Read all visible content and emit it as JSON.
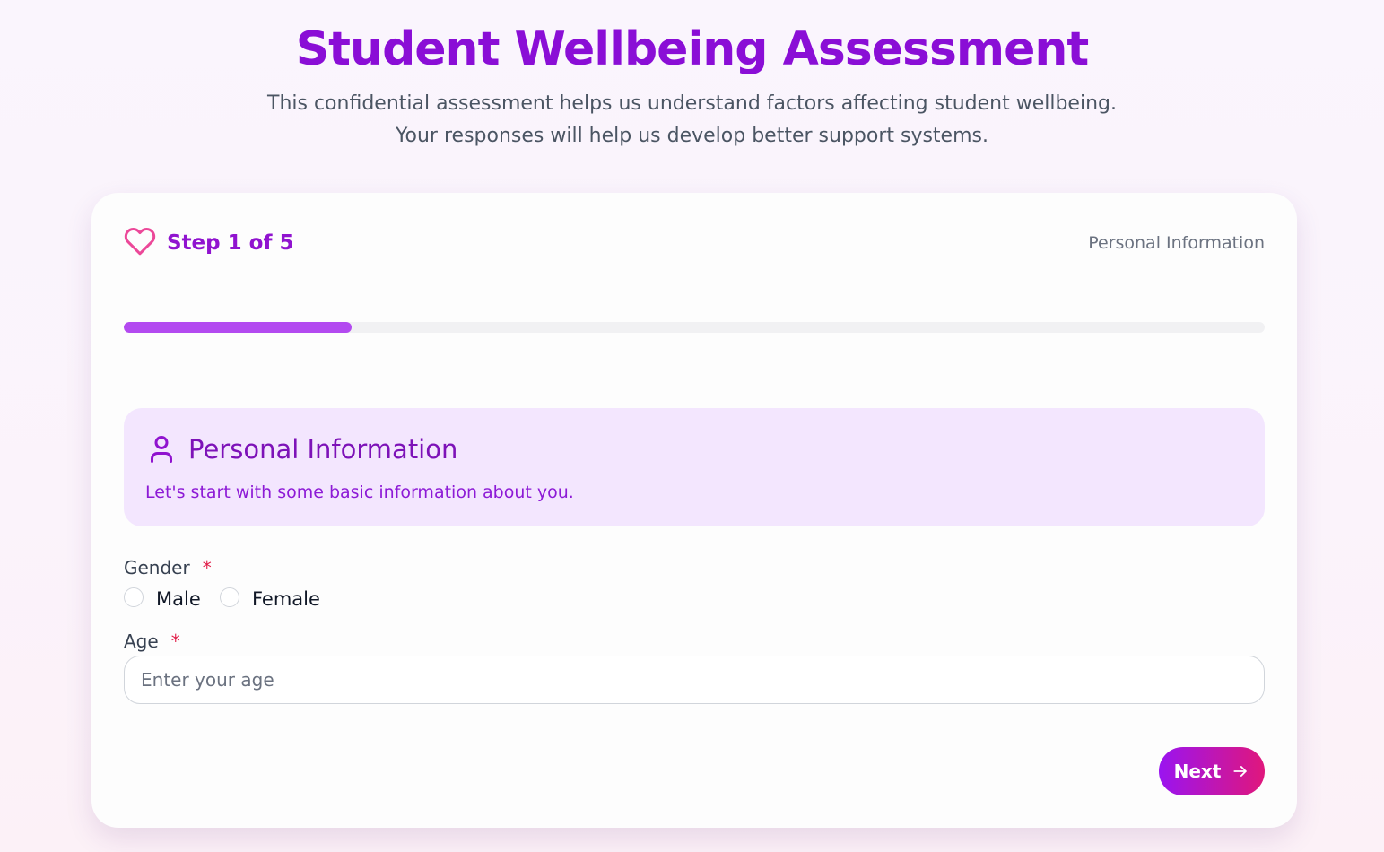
{
  "header": {
    "title": "Student Wellbeing Assessment",
    "intro": "This confidential assessment helps us understand factors affecting student wellbeing. Your responses will help us develop better support systems."
  },
  "progress": {
    "step_label": "Step 1 of 5",
    "current_step": 1,
    "total_steps": 5,
    "step_name": "Personal Information",
    "fraction": 0.2
  },
  "section": {
    "title": "Personal Information",
    "description": "Let's start with some basic information about you."
  },
  "form": {
    "gender": {
      "label": "Gender",
      "required_mark": "*",
      "options": [
        "Male",
        "Female"
      ],
      "selected": null
    },
    "age": {
      "label": "Age",
      "required_mark": "*",
      "placeholder": "Enter your age",
      "value": ""
    }
  },
  "actions": {
    "next_label": "Next"
  },
  "icons": {
    "step": "heart-icon",
    "section": "user-icon",
    "next": "arrow-right-icon"
  },
  "colors": {
    "accent": "#8a0ed6",
    "progress_fill": "#b34af0",
    "section_bg": "#f3e6fe",
    "required": "#e11d48",
    "button_gradient": [
      "#9a14f0",
      "#e0177c"
    ]
  }
}
